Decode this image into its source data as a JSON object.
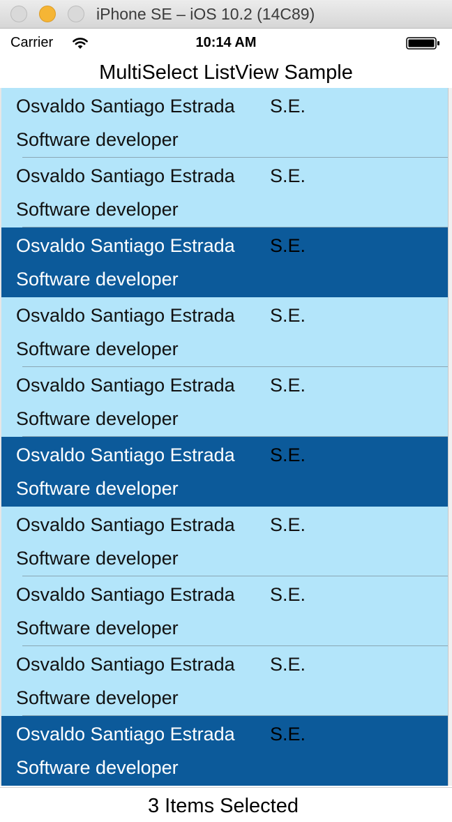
{
  "window": {
    "title": "iPhone SE – iOS 10.2 (14C89)"
  },
  "status_bar": {
    "carrier": "Carrier",
    "time": "10:14 AM"
  },
  "nav": {
    "title": "MultiSelect ListView Sample"
  },
  "list": {
    "items": [
      {
        "name": "Osvaldo Santiago Estrada",
        "suffix": "S.E.",
        "role": "Software developer",
        "selected": false
      },
      {
        "name": "Osvaldo Santiago Estrada",
        "suffix": "S.E.",
        "role": "Software developer",
        "selected": false
      },
      {
        "name": "Osvaldo Santiago Estrada",
        "suffix": "S.E.",
        "role": "Software developer",
        "selected": true
      },
      {
        "name": "Osvaldo Santiago Estrada",
        "suffix": "S.E.",
        "role": "Software developer",
        "selected": false
      },
      {
        "name": "Osvaldo Santiago Estrada",
        "suffix": "S.E.",
        "role": "Software developer",
        "selected": false
      },
      {
        "name": "Osvaldo Santiago Estrada",
        "suffix": "S.E.",
        "role": "Software developer",
        "selected": true
      },
      {
        "name": "Osvaldo Santiago Estrada",
        "suffix": "S.E.",
        "role": "Software developer",
        "selected": false
      },
      {
        "name": "Osvaldo Santiago Estrada",
        "suffix": "S.E.",
        "role": "Software developer",
        "selected": false
      },
      {
        "name": "Osvaldo Santiago Estrada",
        "suffix": "S.E.",
        "role": "Software developer",
        "selected": false
      },
      {
        "name": "Osvaldo Santiago Estrada",
        "suffix": "S.E.",
        "role": "Software developer",
        "selected": true
      }
    ]
  },
  "footer": {
    "text": "3 Items Selected"
  },
  "colors": {
    "row_background": "#b3e5fa",
    "row_selected_background": "#0c5a9a"
  }
}
